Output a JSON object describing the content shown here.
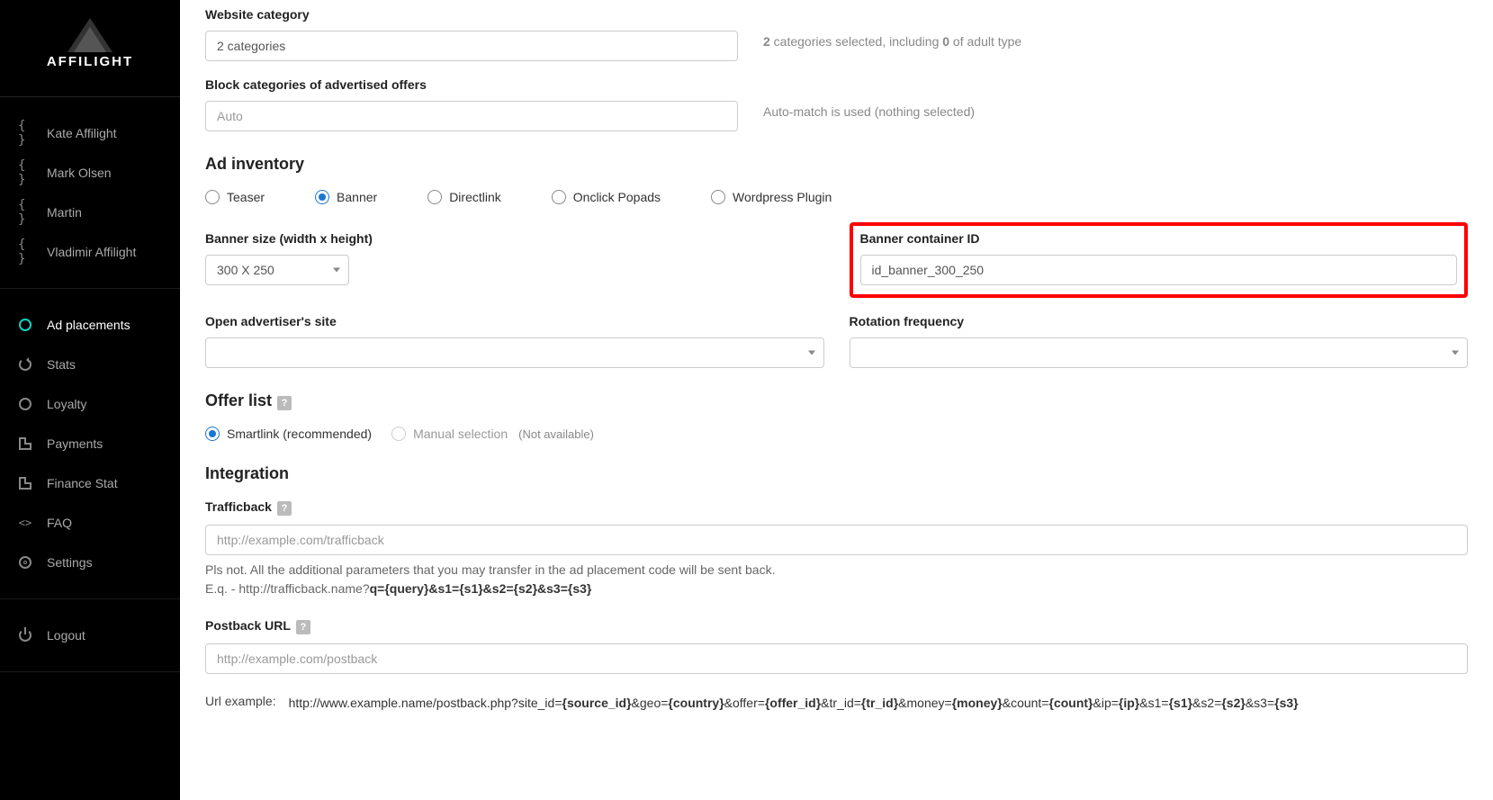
{
  "brand": "AFFILIGHT",
  "sidebar": {
    "users": [
      "Kate Affilight",
      "Mark Olsen",
      "Martin",
      "Vladimir Affilight"
    ],
    "nav": {
      "ad_placements": "Ad placements",
      "stats": "Stats",
      "loyalty": "Loyalty",
      "payments": "Payments",
      "finance_stat": "Finance Stat",
      "faq": "FAQ",
      "settings": "Settings",
      "logout": "Logout"
    }
  },
  "form": {
    "website_category_label": "Website category",
    "website_category_value": "2 categories",
    "website_category_hint_pre": "2",
    "website_category_hint_mid": " categories selected, including ",
    "website_category_hint_num": "0",
    "website_category_hint_post": " of adult type",
    "block_categories_label": "Block categories of advertised offers",
    "block_categories_placeholder": "Auto",
    "block_categories_hint": "Auto-match is used (nothing selected)",
    "ad_inventory_title": "Ad inventory",
    "inventory_options": [
      "Teaser",
      "Banner",
      "Directlink",
      "Onclick Popads",
      "Wordpress Plugin"
    ],
    "banner_size_label": "Banner size (width x height)",
    "banner_size_value": "300 X 250",
    "banner_container_label": "Banner container ID",
    "banner_container_value": "id_banner_300_250",
    "open_adv_label": "Open advertiser's site",
    "rotation_label": "Rotation frequency",
    "offer_list_title": "Offer list",
    "offer_smartlink": "Smartlink (recommended)",
    "offer_manual": "Manual selection",
    "offer_not_available": "(Not available)",
    "integration_title": "Integration",
    "trafficback_label": "Trafficback",
    "trafficback_placeholder": "http://example.com/trafficback",
    "trafficback_note1": "Pls not. All the additional parameters that you may transfer in the ad placement code will be sent back.",
    "trafficback_note2_pre": "E.q. - http://trafficback.name?",
    "trafficback_note2_bold": "q={query}&s1={s1}&s2={s2}&s3={s3}",
    "postback_label": "Postback URL",
    "postback_placeholder": "http://example.com/postback",
    "url_example_label": "Url example:",
    "url_example_parts": [
      {
        "t": "http://www.example.name/postback.php?site_id=",
        "b": false
      },
      {
        "t": "{source_id}",
        "b": true
      },
      {
        "t": "&geo=",
        "b": false
      },
      {
        "t": "{country}",
        "b": true
      },
      {
        "t": "&offer=",
        "b": false
      },
      {
        "t": "{offer_id}",
        "b": true
      },
      {
        "t": "&tr_id=",
        "b": false
      },
      {
        "t": "{tr_id}",
        "b": true
      },
      {
        "t": "&money=",
        "b": false
      },
      {
        "t": "{money}",
        "b": true
      },
      {
        "t": "&count=",
        "b": false
      },
      {
        "t": "{count}",
        "b": true
      },
      {
        "t": "&ip=",
        "b": false
      },
      {
        "t": "{ip}",
        "b": true
      },
      {
        "t": "&s1=",
        "b": false
      },
      {
        "t": "{s1}",
        "b": true
      },
      {
        "t": "&s2=",
        "b": false
      },
      {
        "t": "{s2}",
        "b": true
      },
      {
        "t": "&s3=",
        "b": false
      },
      {
        "t": "{s3}",
        "b": true
      }
    ]
  }
}
